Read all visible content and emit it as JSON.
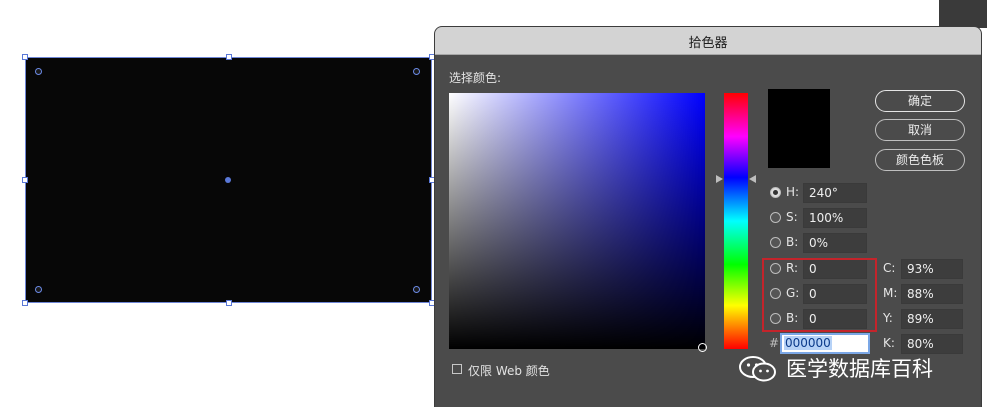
{
  "dialog": {
    "title": "拾色器",
    "select_label": "选择颜色:",
    "buttons": {
      "ok": "确定",
      "cancel": "取消",
      "swatches": "颜色色板"
    },
    "hsb": {
      "h": {
        "label": "H:",
        "value": "240°",
        "selected": true
      },
      "s": {
        "label": "S:",
        "value": "100%"
      },
      "b": {
        "label": "B:",
        "value": "0%"
      }
    },
    "rgb": {
      "r": {
        "label": "R:",
        "value": "0"
      },
      "g": {
        "label": "G:",
        "value": "0"
      },
      "b": {
        "label": "B:",
        "value": "0"
      }
    },
    "cmyk": {
      "c": {
        "label": "C:",
        "value": "93%"
      },
      "m": {
        "label": "M:",
        "value": "88%"
      },
      "y": {
        "label": "Y:",
        "value": "89%"
      },
      "k": {
        "label": "K:",
        "value": "80%"
      }
    },
    "hex": {
      "label": "#",
      "value": "000000"
    },
    "web_colors_only": {
      "label": "仅限 Web 颜色",
      "checked": false
    },
    "current_color": "#000000"
  },
  "colors": {
    "selection_outline": "#5a78d8",
    "highlight_box": "#c4242b",
    "dialog_bg": "#4b4b4b"
  },
  "watermark": {
    "text": "医学数据库百科",
    "icon": "wechat-icon"
  }
}
